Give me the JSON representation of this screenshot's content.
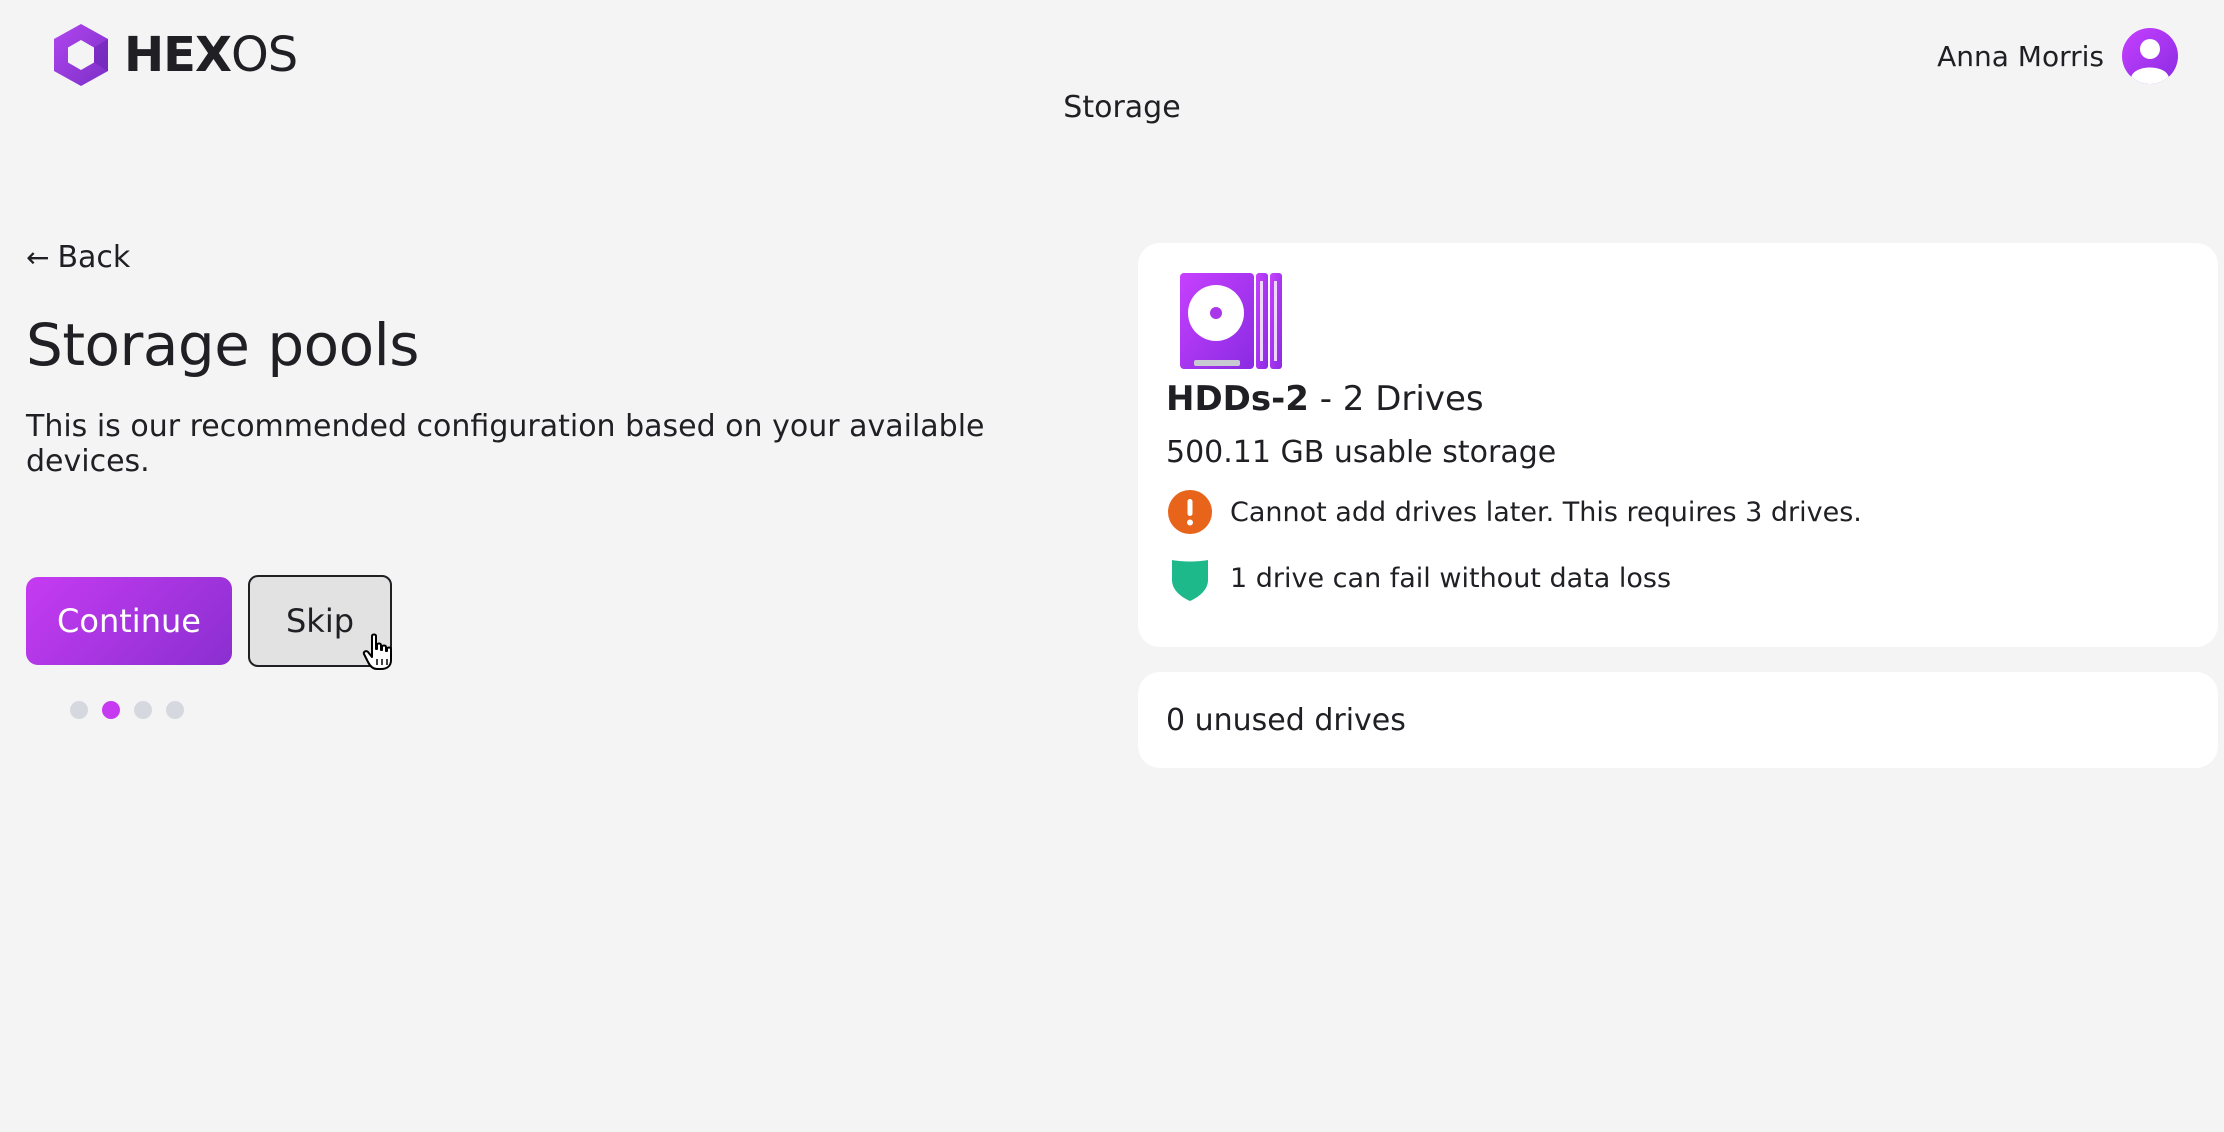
{
  "brand": {
    "wordmark_bold": "HEX",
    "wordmark_light": "OS",
    "accent_color": "#c63bf2"
  },
  "header": {
    "page_title": "Storage",
    "user_name": "Anna Morris"
  },
  "main": {
    "back_label": "Back",
    "title": "Storage pools",
    "description": "This is our recommended configuration based on your available devices.",
    "continue_label": "Continue",
    "skip_label": "Skip",
    "step_dots": {
      "total": 4,
      "active": 2
    }
  },
  "pool": {
    "icon": "hard-drive-icon",
    "name": "HDDs-2",
    "drives_text": " - 2 Drives",
    "usable_storage": "500.11 GB usable storage",
    "warning": "Cannot add drives later. This requires 3 drives.",
    "warning_color": "#e8641a",
    "protection": "1 drive can fail without data loss",
    "protection_color": "#1db98a"
  },
  "unused": {
    "text": "0 unused drives"
  }
}
